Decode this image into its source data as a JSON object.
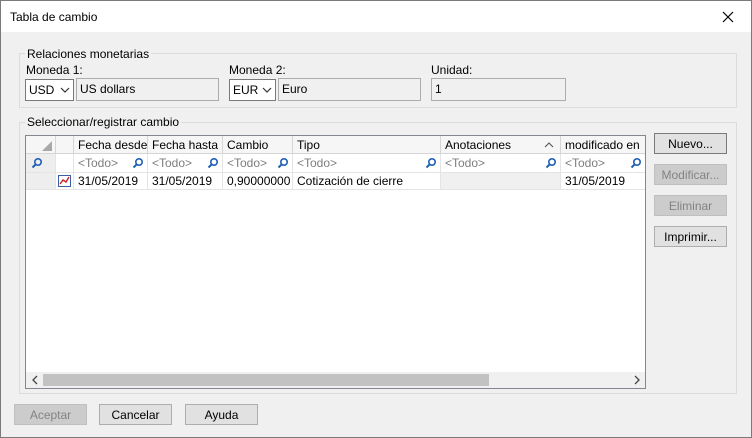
{
  "window": {
    "title": "Tabla de cambio"
  },
  "relaciones": {
    "legend": "Relaciones monetarias",
    "moneda1": {
      "label": "Moneda 1:",
      "code": "USD",
      "name": "US dollars"
    },
    "moneda2": {
      "label": "Moneda 2:",
      "code": "EUR",
      "name": "Euro"
    },
    "unidad": {
      "label": "Unidad:",
      "value": "1"
    }
  },
  "seleccionar": {
    "legend": "Seleccionar/registrar cambio",
    "columns": [
      "Fecha desde",
      "Fecha hasta",
      "Cambio",
      "Tipo",
      "Anotaciones",
      "modificado en"
    ],
    "filter_placeholder": "<Todo>",
    "rows": [
      {
        "fecha_desde": "31/05/2019",
        "fecha_hasta": "31/05/2019",
        "cambio": "0,90000000",
        "tipo": "Cotización de cierre",
        "anotaciones": "",
        "modificado_en": "31/05/2019"
      }
    ]
  },
  "side_buttons": {
    "nuevo": "Nuevo...",
    "modificar": "Modificar...",
    "eliminar": "Eliminar",
    "imprimir": "Imprimir..."
  },
  "footer": {
    "aceptar": "Aceptar",
    "cancelar": "Cancelar",
    "ayuda": "Ayuda"
  },
  "icons": {
    "close": "close-icon",
    "search": "magnifier-icon",
    "row_type": "chart-line-icon"
  },
  "colors": {
    "accent": "#1e5fb4",
    "grid_border": "#828790"
  }
}
